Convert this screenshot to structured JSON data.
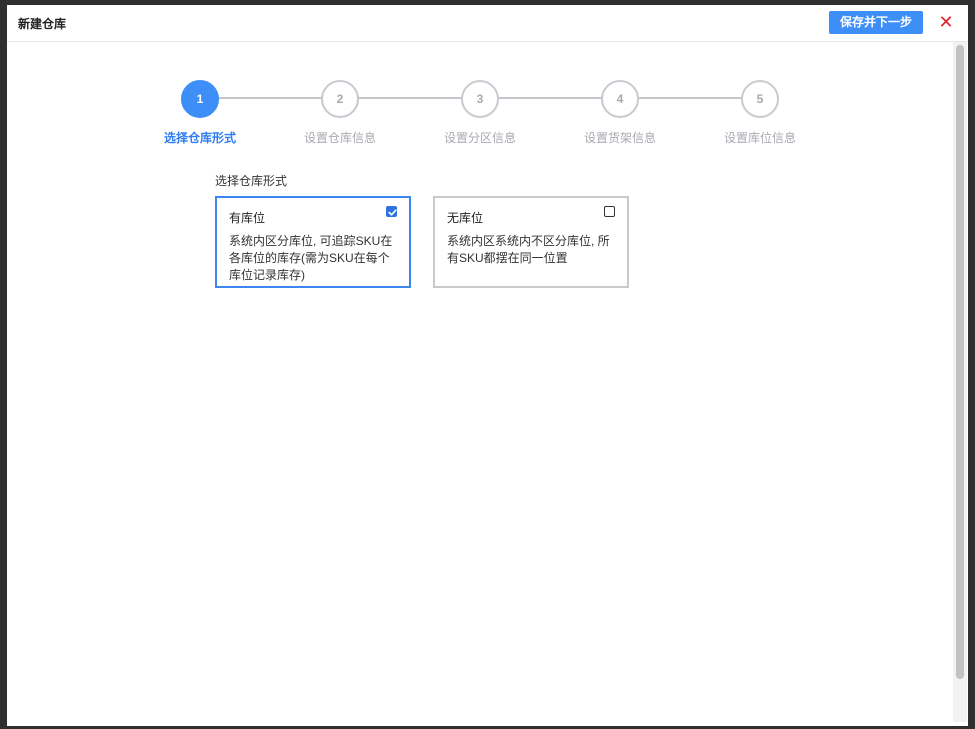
{
  "dialog": {
    "title": "新建仓库",
    "primary_button": "保存并下一步",
    "close_icon": "✕"
  },
  "steps": [
    {
      "number": "1",
      "label": "选择仓库形式",
      "active": true
    },
    {
      "number": "2",
      "label": "设置仓库信息",
      "active": false
    },
    {
      "number": "3",
      "label": "设置分区信息",
      "active": false
    },
    {
      "number": "4",
      "label": "设置货架信息",
      "active": false
    },
    {
      "number": "5",
      "label": "设置库位信息",
      "active": false
    }
  ],
  "form": {
    "section_label": "选择仓库形式",
    "options": [
      {
        "title": "有库位",
        "description": "系统内区分库位, 可追踪SKU在各库位的库存(需为SKU在每个库位记录库存)",
        "checked": true
      },
      {
        "title": "无库位",
        "description": "系统内区系统内不区分库位, 所有SKU都摆在同一位置",
        "checked": false
      }
    ]
  },
  "colors": {
    "accent": "#3d8ef7",
    "close": "#e2222b",
    "inactive_step": "#a7aab1"
  }
}
